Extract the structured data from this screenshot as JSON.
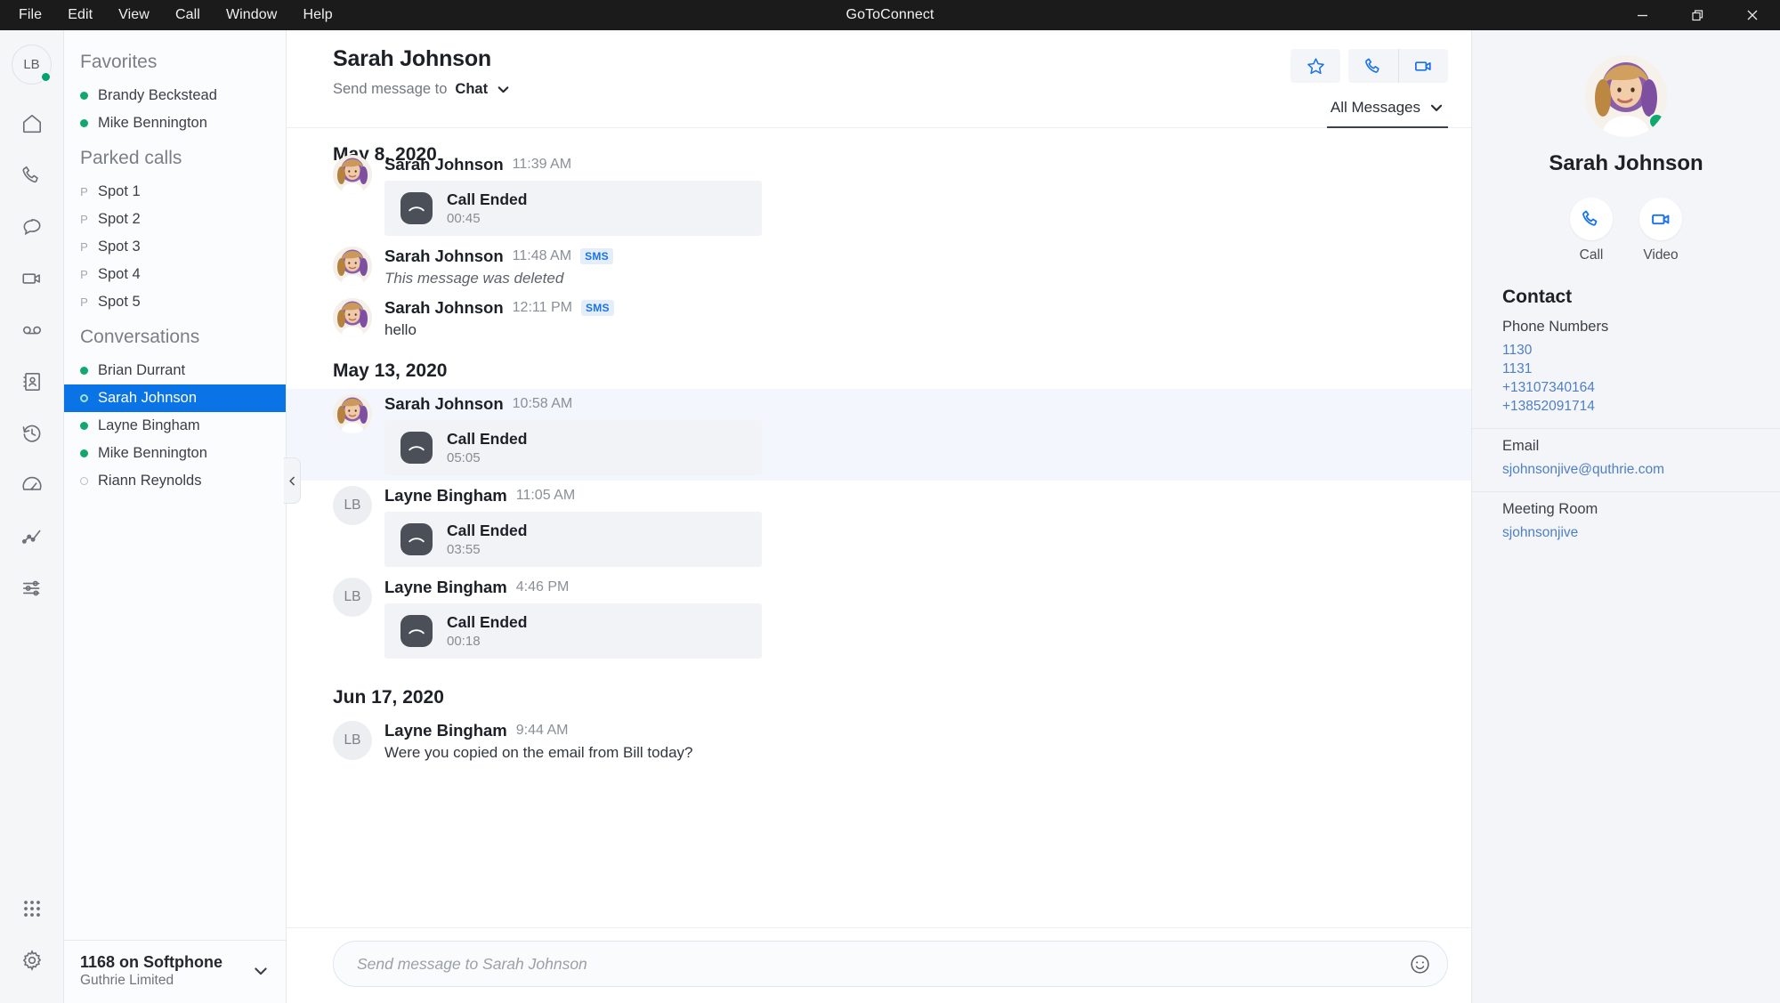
{
  "window": {
    "title": "GoToConnect",
    "menu": [
      "File",
      "Edit",
      "View",
      "Call",
      "Window",
      "Help"
    ],
    "controls": {
      "minimize": "minimize-button",
      "restore": "restore-button",
      "close": "close-button"
    }
  },
  "rail": {
    "avatar_initials": "LB",
    "status": "online",
    "items": [
      {
        "name": "home-icon",
        "label": "Home"
      },
      {
        "name": "phone-icon",
        "label": "Calls"
      },
      {
        "name": "chat-icon",
        "label": "Messages"
      },
      {
        "name": "video-icon",
        "label": "Meetings"
      },
      {
        "name": "voicemail-icon",
        "label": "Voicemail"
      },
      {
        "name": "contacts-icon",
        "label": "Contacts"
      },
      {
        "name": "history-icon",
        "label": "History"
      },
      {
        "name": "gauge-icon",
        "label": "Dashboard"
      },
      {
        "name": "analytics-icon",
        "label": "Analytics"
      },
      {
        "name": "sliders-icon",
        "label": "Preferences"
      }
    ],
    "bottom": [
      {
        "name": "dialpad-icon",
        "label": "Dialpad"
      },
      {
        "name": "gear-icon",
        "label": "Settings"
      }
    ]
  },
  "sidebar": {
    "favorites_header": "Favorites",
    "favorites": [
      {
        "name": "Brandy Beckstead",
        "presence": "on"
      },
      {
        "name": "Mike Bennington",
        "presence": "on"
      }
    ],
    "parked_header": "Parked calls",
    "parked": [
      {
        "mark": "P",
        "name": "Spot 1"
      },
      {
        "mark": "P",
        "name": "Spot 2"
      },
      {
        "mark": "P",
        "name": "Spot 3"
      },
      {
        "mark": "P",
        "name": "Spot 4"
      },
      {
        "mark": "P",
        "name": "Spot 5"
      }
    ],
    "conversations_header": "Conversations",
    "conversations": [
      {
        "name": "Brian Durrant",
        "presence": "on",
        "selected": false
      },
      {
        "name": "Sarah Johnson",
        "presence": "ring",
        "selected": true
      },
      {
        "name": "Layne Bingham",
        "presence": "on",
        "selected": false
      },
      {
        "name": "Mike Bennington",
        "presence": "on",
        "selected": false
      },
      {
        "name": "Riann Reynolds",
        "presence": "off",
        "selected": false
      }
    ],
    "footer": {
      "line": "1168 on Softphone",
      "org": "Guthrie Limited"
    }
  },
  "header": {
    "title": "Sarah Johnson",
    "send_prefix": "Send message to",
    "send_channel": "Chat",
    "actions": [
      {
        "name": "favorite-star-button",
        "label": "Favorite"
      },
      {
        "name": "call-button",
        "label": "Call"
      },
      {
        "name": "video-button",
        "label": "Video"
      }
    ],
    "filter_label": "All Messages"
  },
  "conversation": {
    "groups": [
      {
        "date": "May 8, 2020",
        "messages": [
          {
            "sender": "Sarah Johnson",
            "avatar": "photo",
            "time": "11:39 AM",
            "badge": "",
            "kind": "call",
            "call_title": "Call Ended",
            "duration": "00:45",
            "text": "",
            "highlight": false,
            "clipped": true
          },
          {
            "sender": "Sarah Johnson",
            "avatar": "photo",
            "time": "11:48 AM",
            "badge": "SMS",
            "kind": "text",
            "text": "This message was deleted",
            "deleted": true,
            "highlight": false
          },
          {
            "sender": "Sarah Johnson",
            "avatar": "photo",
            "time": "12:11 PM",
            "badge": "SMS",
            "kind": "text",
            "text": "hello",
            "deleted": false,
            "highlight": false
          }
        ]
      },
      {
        "date": "May 13, 2020",
        "messages": [
          {
            "sender": "Sarah Johnson",
            "avatar": "photo",
            "time": "10:58 AM",
            "badge": "",
            "kind": "call",
            "call_title": "Call Ended",
            "duration": "05:05",
            "text": "",
            "highlight": true
          },
          {
            "sender": "Layne Bingham",
            "avatar": "LB",
            "time": "11:05 AM",
            "badge": "",
            "kind": "call",
            "call_title": "Call Ended",
            "duration": "03:55",
            "text": "",
            "highlight": false
          },
          {
            "sender": "Layne Bingham",
            "avatar": "LB",
            "time": "4:46 PM",
            "badge": "",
            "kind": "call",
            "call_title": "Call Ended",
            "duration": "00:18",
            "text": "",
            "highlight": false
          }
        ]
      },
      {
        "date": "Jun 17, 2020",
        "messages": [
          {
            "sender": "Layne Bingham",
            "avatar": "LB",
            "time": "9:44 AM",
            "badge": "",
            "kind": "text",
            "text": "Were you copied on the email from Bill today?",
            "deleted": false,
            "highlight": false
          }
        ]
      }
    ]
  },
  "composer": {
    "placeholder": "Send message to Sarah Johnson",
    "value": "",
    "emoji_icon": "emoji-icon"
  },
  "contact": {
    "name": "Sarah Johnson",
    "presence": "online",
    "actions": [
      {
        "name": "contact-call-button",
        "label": "Call",
        "icon": "phone-icon"
      },
      {
        "name": "contact-video-button",
        "label": "Video",
        "icon": "video-icon"
      }
    ],
    "section_title": "Contact",
    "phone_label": "Phone Numbers",
    "phones": [
      "1130",
      "1131",
      "+13107340164",
      "+13852091714"
    ],
    "email_label": "Email",
    "email": "sjohnsonjive@quthrie.com",
    "meeting_label": "Meeting Room",
    "meeting_room": "sjohnsonjive"
  },
  "colors": {
    "accent_blue": "#1a73e8",
    "selection_blue": "#0a74e6",
    "presence_green": "#11a86f",
    "titlebar": "#1b1b1b",
    "panel_bg": "#f3f5f8",
    "link_blue": "#4f7fc4"
  }
}
